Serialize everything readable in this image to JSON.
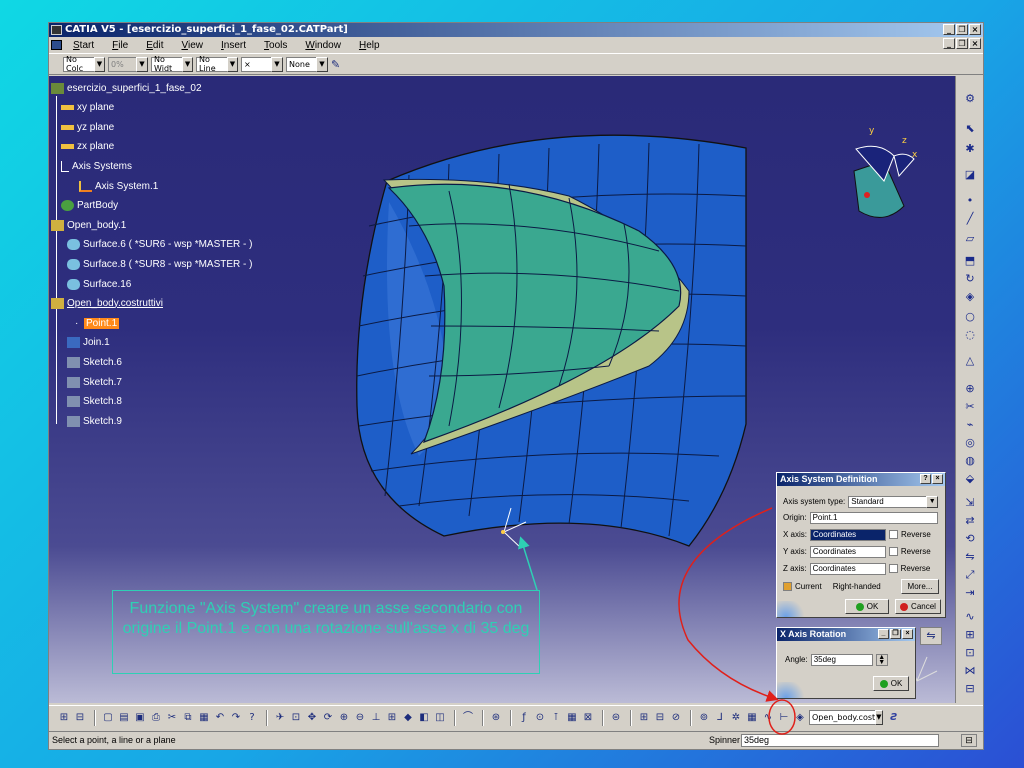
{
  "app": {
    "title": "CATIA V5 - [esercizio_superfici_1_fase_02.CATPart]"
  },
  "menu": [
    "Start",
    "File",
    "Edit",
    "View",
    "Insert",
    "Tools",
    "Window",
    "Help"
  ],
  "properties_bar": {
    "color": "No Colc",
    "transparency": "0%",
    "line_width": "No Widt",
    "line_type": "No Line",
    "point_symbol": "×",
    "layer": "None"
  },
  "tree": {
    "root": "esercizio_superfici_1_fase_02",
    "items": [
      "xy plane",
      "yz plane",
      "zx plane",
      "Axis Systems",
      "Axis System.1",
      "PartBody",
      "Open_body.1",
      "Surface.6 ( *SUR6 - wsp *MASTER - )",
      "Surface.8 ( *SUR8 - wsp *MASTER - )",
      "Surface.16",
      "Open_body.costruttivi",
      "Point.1",
      "Join.1",
      "Sketch.6",
      "Sketch.7",
      "Sketch.8",
      "Sketch.9"
    ]
  },
  "axis_dialog": {
    "title": "Axis System Definition",
    "type_label": "Axis system type:",
    "type_value": "Standard",
    "origin_label": "Origin:",
    "origin_value": "Point.1",
    "x_label": "X axis:",
    "x_value": "Coordinates",
    "y_label": "Y axis:",
    "y_value": "Coordinates",
    "z_label": "Z axis:",
    "z_value": "Coordinates",
    "reverse_label": "Reverse",
    "current_label": "Current",
    "handed_label": "Right-handed",
    "more_label": "More...",
    "ok_label": "OK",
    "cancel_label": "Cancel"
  },
  "rotation_dialog": {
    "title": "X Axis Rotation",
    "angle_label": "Angle:",
    "angle_value": "35deg",
    "ok_label": "OK"
  },
  "annotation": "Funzione \"Axis System\" creare un asse secondario con origine il Point.1 e con una rotazione sull'asse x di 35 deg",
  "compass_labels": {
    "y": "y",
    "z": "z",
    "x": "x"
  },
  "bottom_combo": "Open_body.cost",
  "status": {
    "prompt": "Select a point, a line or a plane",
    "spinner_label": "Spinner",
    "spinner_value": "35deg"
  },
  "colors": {
    "accent_annotation": "#2ed0b4",
    "highlight": "#ff8a1a",
    "arrow": "#e0201a"
  }
}
